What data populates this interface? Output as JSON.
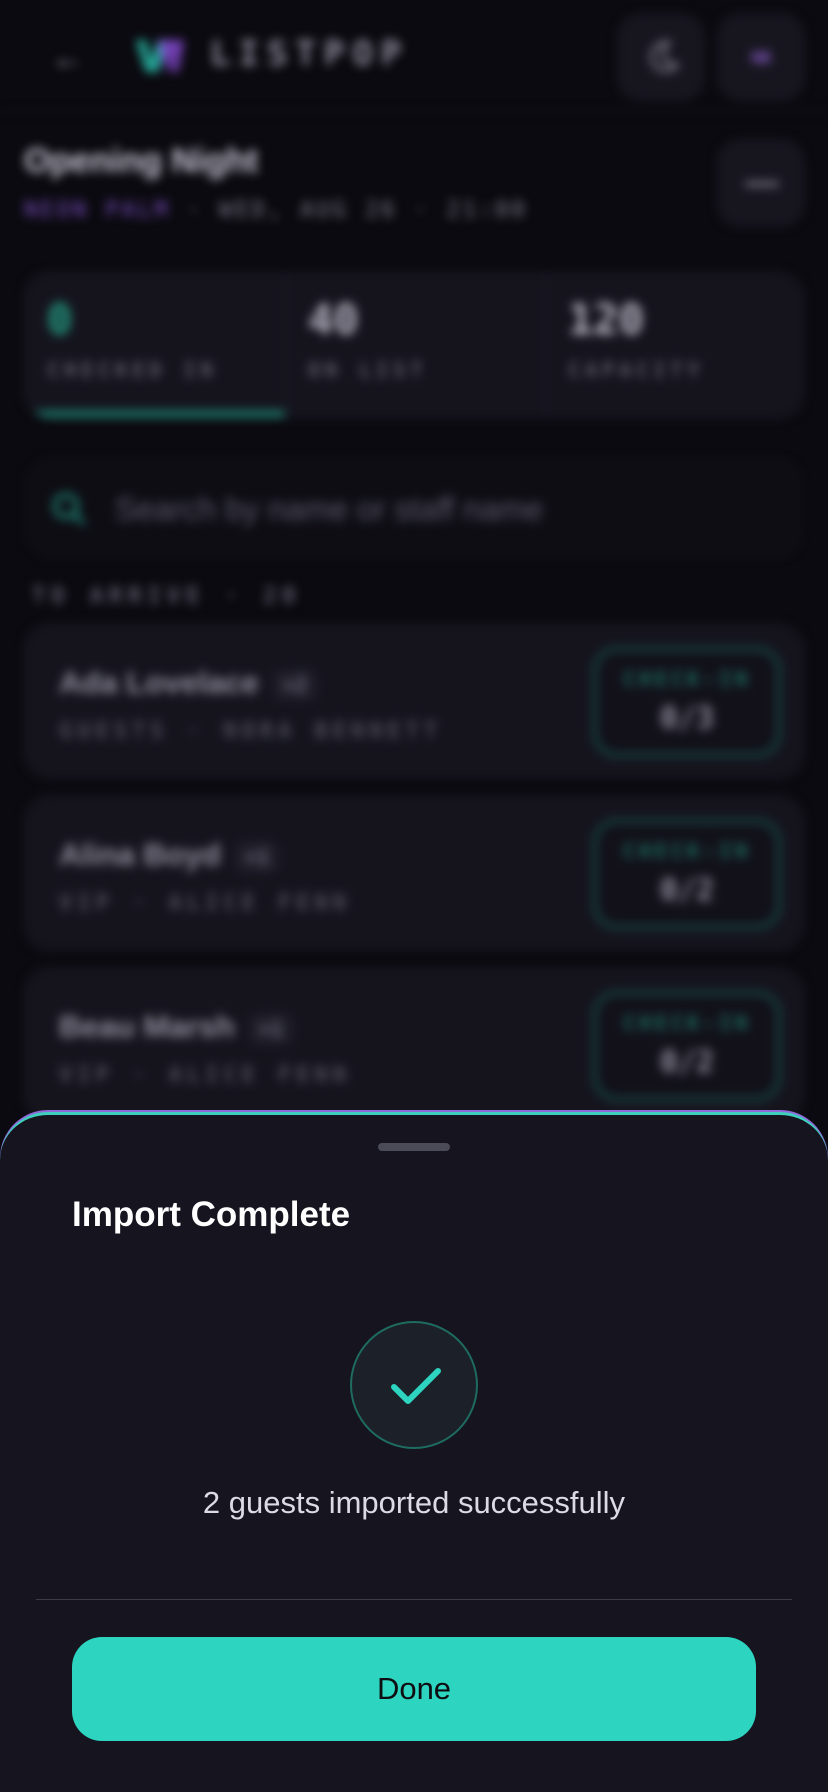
{
  "app": {
    "brand": "LISTPOP",
    "avatar_initials": "NB"
  },
  "event": {
    "title": "Opening Night",
    "venue": "NEON PALM",
    "datetime": " · WED, AUG 26 · 21:00"
  },
  "stats": [
    {
      "value": "0",
      "label": "CHECKED IN"
    },
    {
      "value": "40",
      "label": "ON LIST"
    },
    {
      "value": "120",
      "label": "CAPACITY"
    }
  ],
  "search": {
    "placeholder": "Search by name or staff name"
  },
  "section": {
    "label": "TO ARRIVE · 20"
  },
  "guests": [
    {
      "name": "Ada Lovelace",
      "plus": "+2",
      "meta": "GUESTS · NORA BENNETT",
      "checkin_label": "CHECK-IN",
      "count": "0/3"
    },
    {
      "name": "Alina Boyd",
      "plus": "+1",
      "meta": "VIP · ALICE FENN",
      "checkin_label": "CHECK-IN",
      "count": "0/2"
    },
    {
      "name": "Beau Marsh",
      "plus": "+1",
      "meta": "VIP · ALICE FENN",
      "checkin_label": "CHECK-IN",
      "count": "0/2"
    }
  ],
  "sheet": {
    "title": "Import Complete",
    "message": "2 guests imported successfully",
    "done_label": "Done"
  },
  "colors": {
    "accent": "#2dd4bf",
    "purple": "#8f6ad8",
    "background": "#0b0a10",
    "sheet": "#15141f"
  },
  "progress": {
    "checked_in_fraction": 0
  }
}
